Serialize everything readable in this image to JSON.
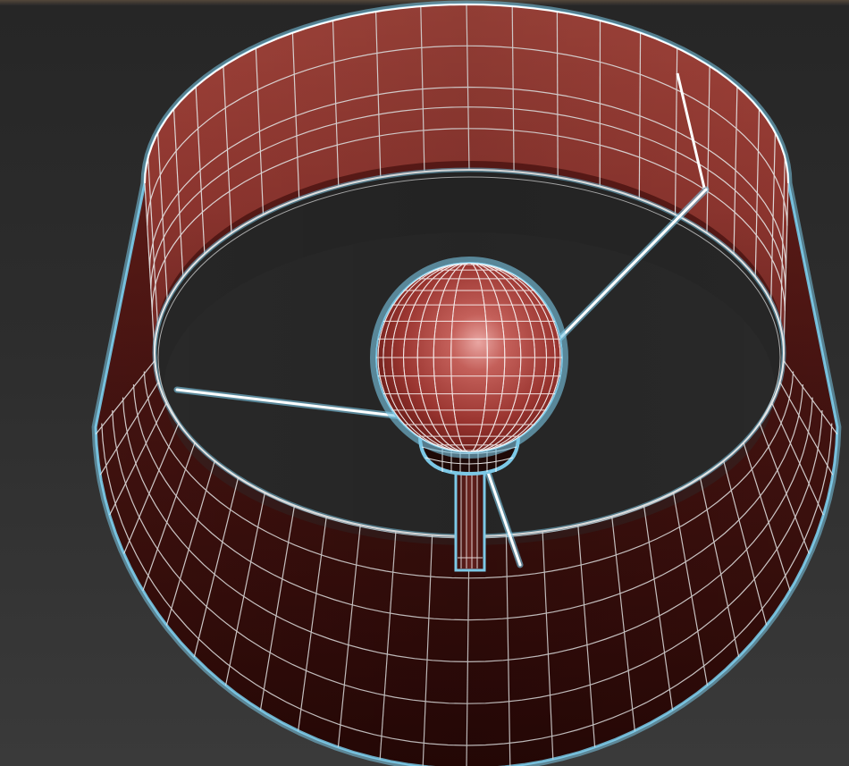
{
  "viewport": {
    "kind": "3d-perspective-viewport",
    "background_color": "#2b2b2b"
  },
  "scene": {
    "objects": [
      {
        "name": "lamp-shade",
        "shape": "tapered-cylinder",
        "color": "#a8443c",
        "shading": "smooth",
        "wireframe": true,
        "selected": true
      },
      {
        "name": "bulb",
        "shape": "sphere",
        "color": "#b24a44",
        "wireframe": true,
        "selected": true
      },
      {
        "name": "bulb-socket",
        "shape": "cylinder",
        "color": "#2a0e0c",
        "wireframe": true,
        "selected": true
      },
      {
        "name": "lamp-stem",
        "shape": "cylinder",
        "color": "#4a1a16",
        "wireframe": true,
        "selected": true
      },
      {
        "name": "shade-support-spokes",
        "count": 3,
        "color": "#ffffff",
        "selected": true
      }
    ],
    "wireframe_color": "#ffffff",
    "selection_outline_color": "#7cc8e6"
  }
}
